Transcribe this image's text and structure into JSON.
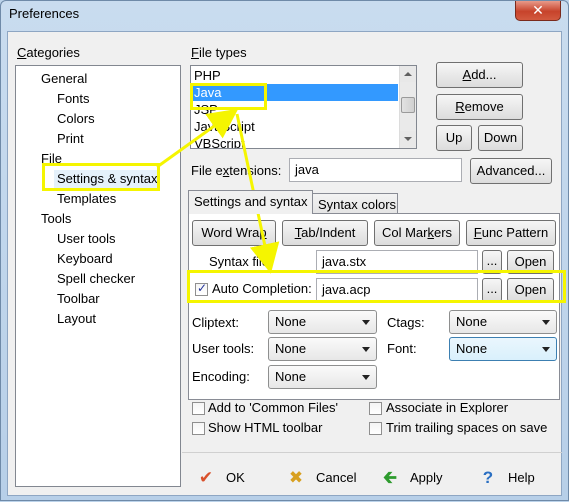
{
  "window": {
    "title": "Preferences",
    "close_label": "✕"
  },
  "categories": {
    "label": "Categories",
    "items": [
      {
        "label": "General",
        "indent": 0
      },
      {
        "label": "Fonts",
        "indent": 1
      },
      {
        "label": "Colors",
        "indent": 1
      },
      {
        "label": "Print",
        "indent": 1
      },
      {
        "label": "File",
        "indent": 0
      },
      {
        "label": "Settings & syntax",
        "indent": 1,
        "selected": true
      },
      {
        "label": "Templates",
        "indent": 1
      },
      {
        "label": "Tools",
        "indent": 0
      },
      {
        "label": "User tools",
        "indent": 1
      },
      {
        "label": "Keyboard",
        "indent": 1
      },
      {
        "label": "Spell checker",
        "indent": 1
      },
      {
        "label": "Toolbar",
        "indent": 1
      },
      {
        "label": "Layout",
        "indent": 1
      }
    ]
  },
  "file_types": {
    "label": "File types",
    "items": [
      "PHP",
      "Java",
      "JSP",
      "JavaScript",
      "VBScript"
    ],
    "selected": "Java"
  },
  "buttons": {
    "add": "Add...",
    "remove": "Remove",
    "up": "Up",
    "down": "Down",
    "advanced": "Advanced..."
  },
  "file_extensions": {
    "label": "File extensions:",
    "value": "java"
  },
  "tabs": [
    {
      "label": "Settings and syntax",
      "active": true
    },
    {
      "label": "Syntax colors",
      "active": false
    }
  ],
  "feature_buttons": {
    "word_wrap": "Word Wrap",
    "tab_indent": "Tab/Indent",
    "col_markers": "Col Markers",
    "func_pattern": "Func Pattern"
  },
  "syntax_file": {
    "label": "Syntax file:",
    "value": "java.stx",
    "browse": "...",
    "open": "Open"
  },
  "auto_completion": {
    "label": "Auto Completion:",
    "checked": true,
    "value": "java.acp",
    "browse": "...",
    "open": "Open"
  },
  "dropdowns": {
    "cliptext": {
      "label": "Cliptext:",
      "value": "None"
    },
    "user_tools": {
      "label": "User tools:",
      "value": "None"
    },
    "encoding": {
      "label": "Encoding:",
      "value": "None"
    },
    "ctags": {
      "label": "Ctags:",
      "value": "None"
    },
    "font": {
      "label": "Font:",
      "value": "None"
    }
  },
  "checkboxes": {
    "common_files": {
      "label": "Add to 'Common Files'",
      "checked": false
    },
    "html_toolbar": {
      "label": "Show HTML toolbar",
      "checked": false
    },
    "associate": {
      "label": "Associate in Explorer",
      "checked": false
    },
    "trim_spaces": {
      "label": "Trim trailing spaces on save",
      "checked": false
    }
  },
  "footer": {
    "ok": "OK",
    "cancel": "Cancel",
    "apply": "Apply",
    "help": "Help"
  },
  "colors": {
    "selection": "#3399ff",
    "highlight_annotation": "#f5f500",
    "ok_icon": "#d9512c",
    "cancel_icon": "#d8a020",
    "apply_icon": "#2e9b2e",
    "help_icon": "#2a6fc2"
  }
}
